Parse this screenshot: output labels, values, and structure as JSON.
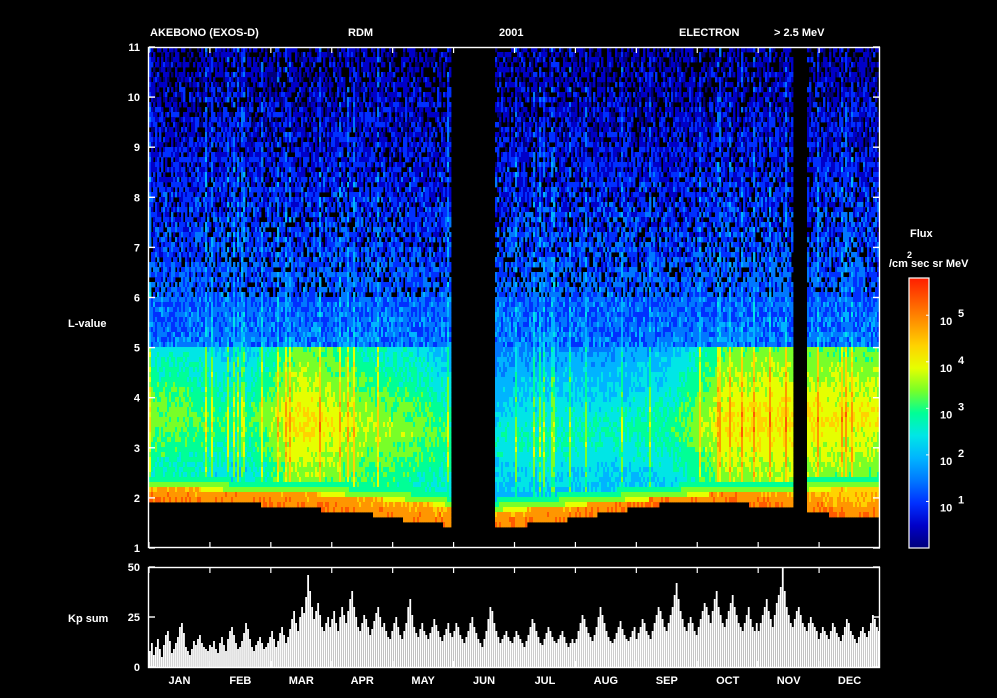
{
  "header": {
    "satellite": "AKEBONO (EXOS-D)",
    "instrument": "RDM",
    "year": "2001",
    "particle": "ELECTRON",
    "energy": "> 2.5 MeV"
  },
  "colorbar": {
    "title": "Flux",
    "units": "/cm sec sr MeV",
    "units_superscript": "2",
    "ticks": [
      {
        "base": "10",
        "exp": "1",
        "value": 10
      },
      {
        "base": "10",
        "exp": "2",
        "value": 100
      },
      {
        "base": "10",
        "exp": "3",
        "value": 1000
      },
      {
        "base": "10",
        "exp": "4",
        "value": 10000
      },
      {
        "base": "10",
        "exp": "5",
        "value": 100000
      }
    ],
    "colors": [
      "#00007a",
      "#0000c8",
      "#0030ff",
      "#0078ff",
      "#00b4ff",
      "#00e6e6",
      "#00ff96",
      "#78ff28",
      "#e6ff00",
      "#ffd200",
      "#ff9600",
      "#ff5a00",
      "#ff1e00"
    ]
  },
  "chart_data": [
    {
      "type": "heatmap",
      "title": "AKEBONO (EXOS-D) RDM 2001 ELECTRON > 2.5 MeV",
      "ylabel": "L-value",
      "ylim": [
        1,
        11
      ],
      "yticks": [
        1,
        2,
        3,
        4,
        5,
        6,
        7,
        8,
        9,
        10,
        11
      ],
      "xlim_day": [
        1,
        365
      ],
      "x_month_labels": [
        "JAN",
        "FEB",
        "MAR",
        "APR",
        "MAY",
        "JUN",
        "JUL",
        "AUG",
        "SEP",
        "OCT",
        "NOV",
        "DEC"
      ],
      "color_scale": "log",
      "colorbar_label": "Flux /cm2 sec sr MeV",
      "data_gaps_days": [
        [
          151,
          173
        ],
        [
          322,
          329
        ]
      ],
      "belt_profile_by_month": [
        {
          "month": "JAN",
          "slot_L": 2.2,
          "inner_edge_L": 1.9,
          "peak_log_flux": 3.0
        },
        {
          "month": "FEB",
          "slot_L": 2.1,
          "inner_edge_L": 1.9,
          "peak_log_flux": 2.6
        },
        {
          "month": "MAR",
          "slot_L": 2.1,
          "inner_edge_L": 1.8,
          "peak_log_flux": 3.8
        },
        {
          "month": "APR",
          "slot_L": 2.0,
          "inner_edge_L": 1.7,
          "peak_log_flux": 3.3
        },
        {
          "month": "MAY",
          "slot_L": 1.9,
          "inner_edge_L": 1.5,
          "peak_log_flux": 3.0
        },
        {
          "month": "JUN",
          "slot_L": 1.7,
          "inner_edge_L": 1.4,
          "peak_log_flux": 2.3
        },
        {
          "month": "JUL",
          "slot_L": 1.8,
          "inner_edge_L": 1.5,
          "peak_log_flux": 2.5
        },
        {
          "month": "AUG",
          "slot_L": 1.9,
          "inner_edge_L": 1.7,
          "peak_log_flux": 2.4
        },
        {
          "month": "SEP",
          "slot_L": 2.0,
          "inner_edge_L": 1.9,
          "peak_log_flux": 2.6
        },
        {
          "month": "OCT",
          "slot_L": 2.1,
          "inner_edge_L": 1.9,
          "peak_log_flux": 3.7
        },
        {
          "month": "NOV",
          "slot_L": 2.1,
          "inner_edge_L": 1.8,
          "peak_log_flux": 3.8
        },
        {
          "month": "DEC",
          "slot_L": 2.2,
          "inner_edge_L": 1.6,
          "peak_log_flux": 3.6
        }
      ]
    },
    {
      "type": "bar",
      "ylabel": "Kp sum",
      "ylim": [
        0,
        50
      ],
      "yticks": [
        0,
        25,
        50
      ],
      "x_month_labels": [
        "JAN",
        "FEB",
        "MAR",
        "APR",
        "MAY",
        "JUN",
        "JUL",
        "AUG",
        "SEP",
        "OCT",
        "NOV",
        "DEC"
      ],
      "monthly_values": [
        {
          "month": "JAN",
          "values": [
            8,
            12,
            6,
            10,
            14,
            9,
            5,
            11,
            16,
            18,
            13,
            7,
            9,
            12,
            15,
            20,
            22,
            17,
            10,
            8,
            6,
            9,
            13,
            11,
            14,
            16,
            12,
            10,
            9,
            8,
            11
          ]
        },
        {
          "month": "FEB",
          "values": [
            10,
            13,
            9,
            7,
            12,
            15,
            11,
            8,
            14,
            18,
            20,
            16,
            12,
            9,
            10,
            13,
            17,
            22,
            19,
            14,
            10,
            8,
            11,
            13,
            15,
            12,
            9,
            10
          ]
        },
        {
          "month": "MAR",
          "values": [
            12,
            15,
            18,
            14,
            10,
            13,
            17,
            20,
            16,
            12,
            15,
            19,
            24,
            28,
            22,
            18,
            25,
            30,
            27,
            35,
            46,
            38,
            30,
            24,
            28,
            32,
            26,
            20,
            18,
            22,
            25
          ]
        },
        {
          "month": "APR",
          "values": [
            20,
            24,
            28,
            22,
            18,
            25,
            30,
            26,
            22,
            28,
            34,
            38,
            30,
            25,
            20,
            18,
            22,
            26,
            24,
            20,
            16,
            19,
            23,
            27,
            30,
            25,
            20,
            22,
            18,
            15
          ]
        },
        {
          "month": "MAY",
          "values": [
            14,
            18,
            22,
            25,
            20,
            16,
            14,
            18,
            22,
            30,
            34,
            26,
            20,
            17,
            15,
            19,
            22,
            18,
            16,
            14,
            17,
            20,
            24,
            21,
            18,
            15,
            13,
            16,
            19,
            22,
            17
          ]
        },
        {
          "month": "JUN",
          "values": [
            15,
            18,
            22,
            20,
            16,
            14,
            12,
            15,
            18,
            22,
            25,
            20,
            17,
            14,
            12,
            10,
            14,
            18,
            24,
            30,
            28,
            22,
            18,
            15,
            12,
            14,
            16,
            18,
            15,
            13
          ]
        },
        {
          "month": "JUL",
          "values": [
            12,
            15,
            18,
            16,
            14,
            12,
            10,
            13,
            16,
            20,
            24,
            22,
            18,
            15,
            12,
            11,
            14,
            17,
            20,
            18,
            15,
            13,
            12,
            14,
            16,
            18,
            15,
            12,
            10,
            12,
            14
          ]
        },
        {
          "month": "AUG",
          "values": [
            12,
            14,
            18,
            22,
            26,
            24,
            20,
            17,
            15,
            13,
            16,
            20,
            25,
            30,
            26,
            22,
            18,
            15,
            13,
            12,
            14,
            17,
            20,
            23,
            19,
            16,
            14,
            13,
            15,
            18,
            20
          ]
        },
        {
          "month": "SEP",
          "values": [
            14,
            17,
            20,
            24,
            22,
            18,
            16,
            14,
            18,
            22,
            26,
            30,
            28,
            24,
            20,
            18,
            22,
            26,
            30,
            36,
            42,
            34,
            28,
            24,
            20,
            18,
            22,
            25,
            22,
            18
          ]
        },
        {
          "month": "OCT",
          "values": [
            16,
            20,
            24,
            28,
            32,
            30,
            26,
            22,
            28,
            34,
            38,
            30,
            26,
            22,
            20,
            24,
            28,
            32,
            36,
            30,
            26,
            22,
            20,
            18,
            22,
            26,
            30,
            24,
            20,
            18,
            22
          ]
        },
        {
          "month": "NOV",
          "values": [
            18,
            22,
            26,
            30,
            34,
            28,
            24,
            20,
            26,
            32,
            36,
            40,
            50,
            38,
            30,
            26,
            22,
            20,
            24,
            28,
            30,
            26,
            22,
            20,
            18,
            22,
            25,
            22,
            20,
            18
          ]
        },
        {
          "month": "DEC",
          "values": [
            14,
            17,
            20,
            18,
            16,
            14,
            18,
            22,
            20,
            17,
            15,
            13,
            16,
            20,
            24,
            22,
            18,
            16,
            14,
            12,
            15,
            18,
            20,
            17,
            15,
            18,
            22,
            26,
            24,
            20,
            18
          ]
        }
      ]
    }
  ]
}
